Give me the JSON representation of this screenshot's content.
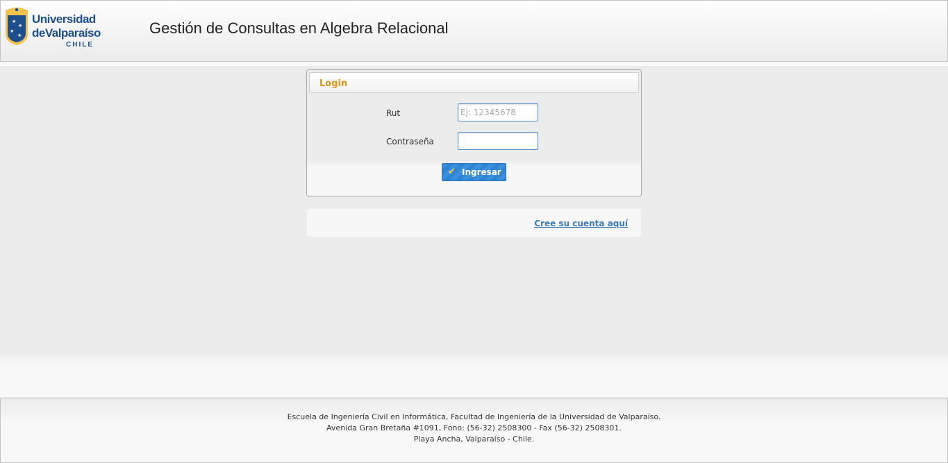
{
  "header": {
    "logo": {
      "line1": "Universidad",
      "line2": "deValparaíso",
      "line3": "CHILE"
    },
    "title": "Gestión de Consultas en Algebra Relacional"
  },
  "login": {
    "title": "Login",
    "rut_label": "Rut",
    "rut_placeholder": "Ej: 12345678",
    "rut_value": "",
    "password_label": "Contraseña",
    "password_value": "",
    "submit_label": "Ingresar",
    "submit_icon": "check-icon"
  },
  "signup": {
    "link_label": "Cree su cuenta aquí"
  },
  "footer": {
    "line1": "Escuela de Ingeniería Civil en Informática, Facultad de Ingeniería de la Universidad de Valparaíso.",
    "line2": "Avenida Gran Bretaña #1091, Fono: (56-32) 2508300 - Fax (56-32) 2508301.",
    "line3": "Playa Ancha, Valparaíso - Chile."
  },
  "colors": {
    "brand_blue": "#1d4f8c",
    "login_title": "#e0921d",
    "button_blue": "#3a90dc",
    "link_blue": "#3a7ab8"
  }
}
